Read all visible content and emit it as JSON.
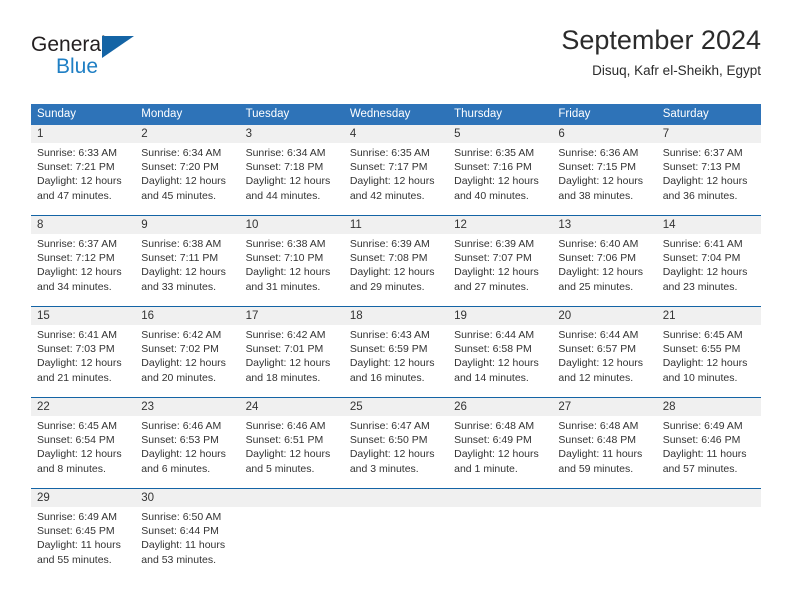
{
  "brand": {
    "name_part1": "General",
    "name_part2": "Blue",
    "accent_color": "#1464a5",
    "blue_text_color": "#1f7fc4"
  },
  "header": {
    "title": "September 2024",
    "subtitle": "Disuq, Kafr el-Sheikh, Egypt"
  },
  "calendar": {
    "header_bg": "#2e73b8",
    "daynum_bg": "#f0f0f0",
    "row_divider_color": "#1464a5",
    "weekdays": [
      "Sunday",
      "Monday",
      "Tuesday",
      "Wednesday",
      "Thursday",
      "Friday",
      "Saturday"
    ],
    "weeks": [
      {
        "days": [
          {
            "num": "1",
            "sunrise": "Sunrise: 6:33 AM",
            "sunset": "Sunset: 7:21 PM",
            "daylight1": "Daylight: 12 hours",
            "daylight2": "and 47 minutes."
          },
          {
            "num": "2",
            "sunrise": "Sunrise: 6:34 AM",
            "sunset": "Sunset: 7:20 PM",
            "daylight1": "Daylight: 12 hours",
            "daylight2": "and 45 minutes."
          },
          {
            "num": "3",
            "sunrise": "Sunrise: 6:34 AM",
            "sunset": "Sunset: 7:18 PM",
            "daylight1": "Daylight: 12 hours",
            "daylight2": "and 44 minutes."
          },
          {
            "num": "4",
            "sunrise": "Sunrise: 6:35 AM",
            "sunset": "Sunset: 7:17 PM",
            "daylight1": "Daylight: 12 hours",
            "daylight2": "and 42 minutes."
          },
          {
            "num": "5",
            "sunrise": "Sunrise: 6:35 AM",
            "sunset": "Sunset: 7:16 PM",
            "daylight1": "Daylight: 12 hours",
            "daylight2": "and 40 minutes."
          },
          {
            "num": "6",
            "sunrise": "Sunrise: 6:36 AM",
            "sunset": "Sunset: 7:15 PM",
            "daylight1": "Daylight: 12 hours",
            "daylight2": "and 38 minutes."
          },
          {
            "num": "7",
            "sunrise": "Sunrise: 6:37 AM",
            "sunset": "Sunset: 7:13 PM",
            "daylight1": "Daylight: 12 hours",
            "daylight2": "and 36 minutes."
          }
        ]
      },
      {
        "days": [
          {
            "num": "8",
            "sunrise": "Sunrise: 6:37 AM",
            "sunset": "Sunset: 7:12 PM",
            "daylight1": "Daylight: 12 hours",
            "daylight2": "and 34 minutes."
          },
          {
            "num": "9",
            "sunrise": "Sunrise: 6:38 AM",
            "sunset": "Sunset: 7:11 PM",
            "daylight1": "Daylight: 12 hours",
            "daylight2": "and 33 minutes."
          },
          {
            "num": "10",
            "sunrise": "Sunrise: 6:38 AM",
            "sunset": "Sunset: 7:10 PM",
            "daylight1": "Daylight: 12 hours",
            "daylight2": "and 31 minutes."
          },
          {
            "num": "11",
            "sunrise": "Sunrise: 6:39 AM",
            "sunset": "Sunset: 7:08 PM",
            "daylight1": "Daylight: 12 hours",
            "daylight2": "and 29 minutes."
          },
          {
            "num": "12",
            "sunrise": "Sunrise: 6:39 AM",
            "sunset": "Sunset: 7:07 PM",
            "daylight1": "Daylight: 12 hours",
            "daylight2": "and 27 minutes."
          },
          {
            "num": "13",
            "sunrise": "Sunrise: 6:40 AM",
            "sunset": "Sunset: 7:06 PM",
            "daylight1": "Daylight: 12 hours",
            "daylight2": "and 25 minutes."
          },
          {
            "num": "14",
            "sunrise": "Sunrise: 6:41 AM",
            "sunset": "Sunset: 7:04 PM",
            "daylight1": "Daylight: 12 hours",
            "daylight2": "and 23 minutes."
          }
        ]
      },
      {
        "days": [
          {
            "num": "15",
            "sunrise": "Sunrise: 6:41 AM",
            "sunset": "Sunset: 7:03 PM",
            "daylight1": "Daylight: 12 hours",
            "daylight2": "and 21 minutes."
          },
          {
            "num": "16",
            "sunrise": "Sunrise: 6:42 AM",
            "sunset": "Sunset: 7:02 PM",
            "daylight1": "Daylight: 12 hours",
            "daylight2": "and 20 minutes."
          },
          {
            "num": "17",
            "sunrise": "Sunrise: 6:42 AM",
            "sunset": "Sunset: 7:01 PM",
            "daylight1": "Daylight: 12 hours",
            "daylight2": "and 18 minutes."
          },
          {
            "num": "18",
            "sunrise": "Sunrise: 6:43 AM",
            "sunset": "Sunset: 6:59 PM",
            "daylight1": "Daylight: 12 hours",
            "daylight2": "and 16 minutes."
          },
          {
            "num": "19",
            "sunrise": "Sunrise: 6:44 AM",
            "sunset": "Sunset: 6:58 PM",
            "daylight1": "Daylight: 12 hours",
            "daylight2": "and 14 minutes."
          },
          {
            "num": "20",
            "sunrise": "Sunrise: 6:44 AM",
            "sunset": "Sunset: 6:57 PM",
            "daylight1": "Daylight: 12 hours",
            "daylight2": "and 12 minutes."
          },
          {
            "num": "21",
            "sunrise": "Sunrise: 6:45 AM",
            "sunset": "Sunset: 6:55 PM",
            "daylight1": "Daylight: 12 hours",
            "daylight2": "and 10 minutes."
          }
        ]
      },
      {
        "days": [
          {
            "num": "22",
            "sunrise": "Sunrise: 6:45 AM",
            "sunset": "Sunset: 6:54 PM",
            "daylight1": "Daylight: 12 hours",
            "daylight2": "and 8 minutes."
          },
          {
            "num": "23",
            "sunrise": "Sunrise: 6:46 AM",
            "sunset": "Sunset: 6:53 PM",
            "daylight1": "Daylight: 12 hours",
            "daylight2": "and 6 minutes."
          },
          {
            "num": "24",
            "sunrise": "Sunrise: 6:46 AM",
            "sunset": "Sunset: 6:51 PM",
            "daylight1": "Daylight: 12 hours",
            "daylight2": "and 5 minutes."
          },
          {
            "num": "25",
            "sunrise": "Sunrise: 6:47 AM",
            "sunset": "Sunset: 6:50 PM",
            "daylight1": "Daylight: 12 hours",
            "daylight2": "and 3 minutes."
          },
          {
            "num": "26",
            "sunrise": "Sunrise: 6:48 AM",
            "sunset": "Sunset: 6:49 PM",
            "daylight1": "Daylight: 12 hours",
            "daylight2": "and 1 minute."
          },
          {
            "num": "27",
            "sunrise": "Sunrise: 6:48 AM",
            "sunset": "Sunset: 6:48 PM",
            "daylight1": "Daylight: 11 hours",
            "daylight2": "and 59 minutes."
          },
          {
            "num": "28",
            "sunrise": "Sunrise: 6:49 AM",
            "sunset": "Sunset: 6:46 PM",
            "daylight1": "Daylight: 11 hours",
            "daylight2": "and 57 minutes."
          }
        ]
      },
      {
        "days": [
          {
            "num": "29",
            "sunrise": "Sunrise: 6:49 AM",
            "sunset": "Sunset: 6:45 PM",
            "daylight1": "Daylight: 11 hours",
            "daylight2": "and 55 minutes."
          },
          {
            "num": "30",
            "sunrise": "Sunrise: 6:50 AM",
            "sunset": "Sunset: 6:44 PM",
            "daylight1": "Daylight: 11 hours",
            "daylight2": "and 53 minutes."
          }
        ]
      }
    ]
  }
}
